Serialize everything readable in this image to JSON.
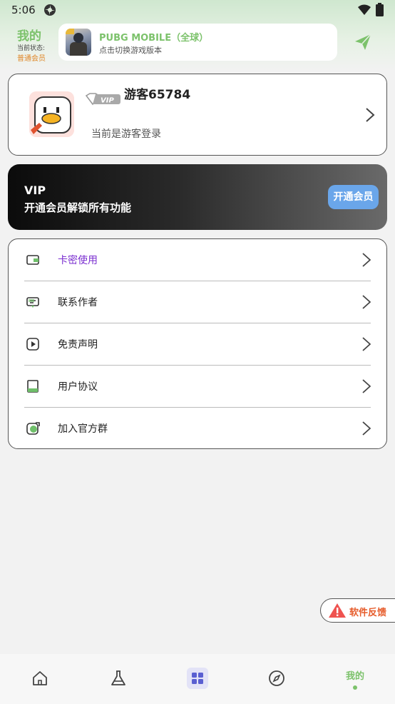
{
  "status_bar": {
    "time": "5:06"
  },
  "header": {
    "title": "我的",
    "state_label": "当前状态:",
    "member_level": "普通会员",
    "game": {
      "name": "PUBG MOBILE（全球）",
      "subtitle": "点击切换游戏版本"
    }
  },
  "profile": {
    "username": "游客65784",
    "vip_badge": "VIP",
    "login_state": "当前是游客登录"
  },
  "vip_banner": {
    "title": "VIP",
    "description": "开通会员解锁所有功能",
    "button": "开通会员"
  },
  "menu": {
    "items": [
      {
        "label": "卡密使用",
        "icon": "wallet-icon"
      },
      {
        "label": "联系作者",
        "icon": "chat-icon"
      },
      {
        "label": "免责声明",
        "icon": "play-icon"
      },
      {
        "label": "用户协议",
        "icon": "book-icon"
      },
      {
        "label": "加入官方群",
        "icon": "group-icon"
      }
    ]
  },
  "feedback": {
    "label": "软件反馈"
  },
  "bottom_nav": {
    "items": [
      {
        "icon": "home-icon"
      },
      {
        "icon": "flask-icon"
      },
      {
        "icon": "grid-icon"
      },
      {
        "icon": "compass-icon"
      },
      {
        "label": "我的"
      }
    ]
  },
  "colors": {
    "accent_green": "#7cc26b",
    "member_orange": "#e0882a",
    "active_purple": "#7b2fd0",
    "vip_button_blue": "#6aa6ea",
    "feedback_red": "#e65b2a"
  }
}
